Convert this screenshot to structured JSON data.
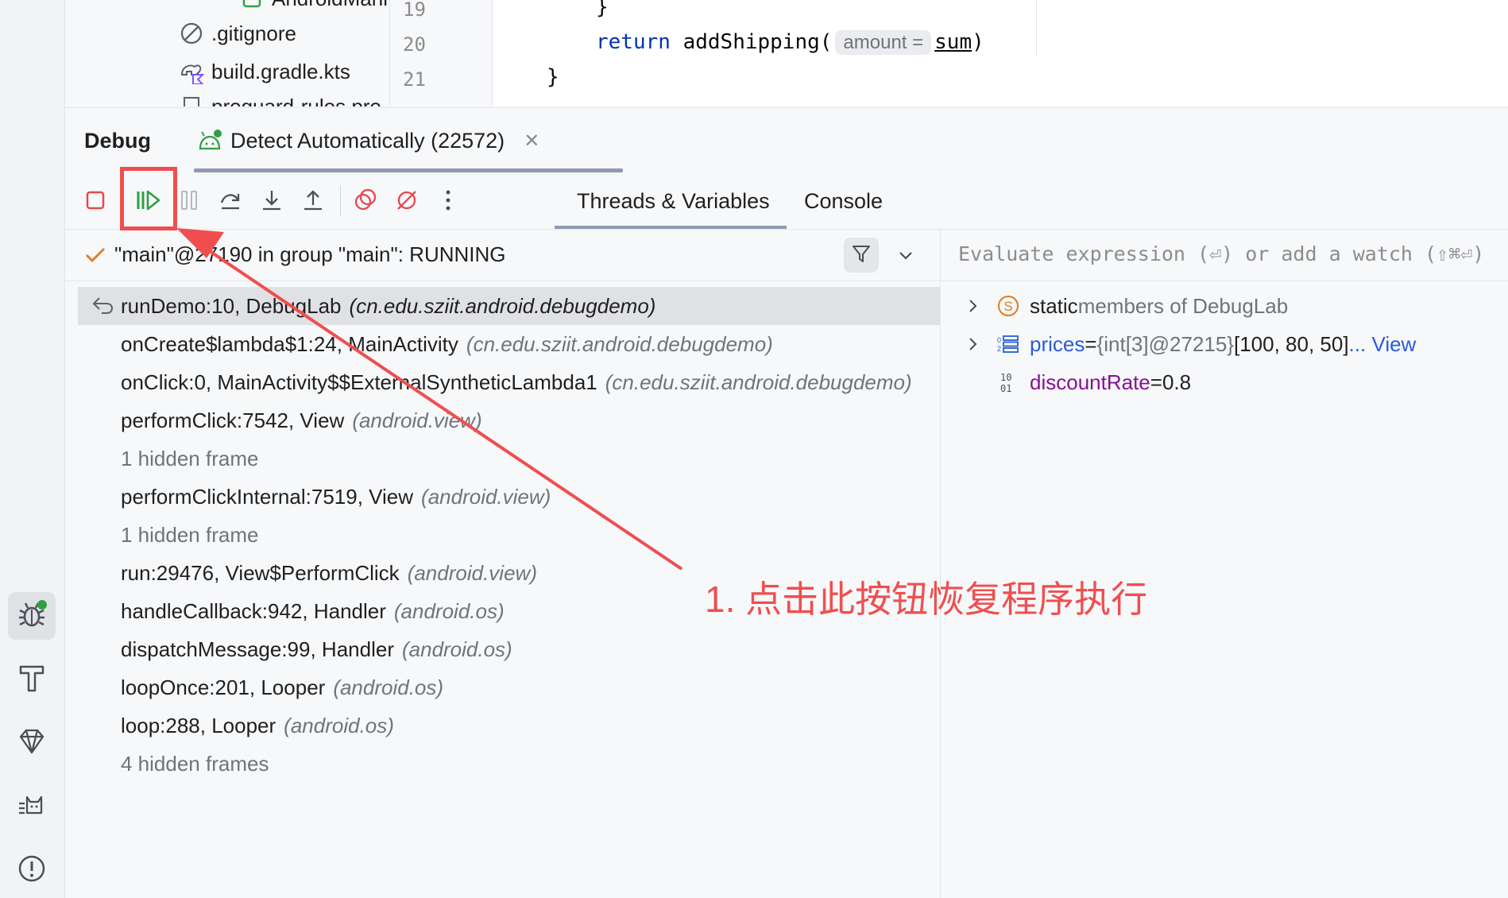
{
  "project_tree": {
    "items": [
      {
        "label": "AndroidMani",
        "icon": "android-manifest-icon"
      },
      {
        "label": ".gitignore",
        "icon": "ignore-file-icon"
      },
      {
        "label": "build.gradle.kts",
        "icon": "gradle-kotlin-icon"
      },
      {
        "label": "proguard-rules.pro",
        "icon": "file-icon"
      }
    ]
  },
  "editor": {
    "line_numbers": [
      "19",
      "20",
      "21"
    ],
    "lines": {
      "l19": "}",
      "l20_keyword": "return",
      "l20_call": "addShipping(",
      "l20_hint": "amount =",
      "l20_arg": "sum",
      "l20_close": ")",
      "l21": "}"
    }
  },
  "debug": {
    "title": "Debug",
    "session_tab": "Detect Automatically (22572)",
    "tabs": [
      "Threads & Variables",
      "Console"
    ],
    "thread_status": "\"main\"@27190 in group \"main\": RUNNING",
    "frames": [
      {
        "method": "runDemo:10, DebugLab",
        "pkg": "(cn.edu.sziit.android.debugdemo)",
        "selected": true
      },
      {
        "method": "onCreate$lambda$1:24, MainActivity",
        "pkg": "(cn.edu.sziit.android.debugdemo)"
      },
      {
        "method": "onClick:0, MainActivity$$ExternalSyntheticLambda1",
        "pkg": "(cn.edu.sziit.android.debugdemo)"
      },
      {
        "method": "performClick:7542, View",
        "pkg": "(android.view)"
      },
      {
        "method": "1 hidden frame",
        "pkg": "",
        "hidden": true
      },
      {
        "method": "performClickInternal:7519, View",
        "pkg": "(android.view)"
      },
      {
        "method": "1 hidden frame",
        "pkg": "",
        "hidden": true
      },
      {
        "method": "run:29476, View$PerformClick",
        "pkg": "(android.view)"
      },
      {
        "method": "handleCallback:942, Handler",
        "pkg": "(android.os)"
      },
      {
        "method": "dispatchMessage:99, Handler",
        "pkg": "(android.os)"
      },
      {
        "method": "loopOnce:201, Looper",
        "pkg": "(android.os)"
      },
      {
        "method": "loop:288, Looper",
        "pkg": "(android.os)"
      },
      {
        "method": "4 hidden frames",
        "pkg": "",
        "hidden": true
      }
    ],
    "eval_placeholder": "Evaluate expression (⏎) or add a watch (⇧⌘⏎)",
    "variables": [
      {
        "name": "static",
        "rest": " members of DebugLab",
        "icon": "static-members-icon"
      },
      {
        "name": "prices",
        "eq": " = ",
        "type": "{int[3]@27215}",
        "value": " [100, 80, 50] ",
        "link": "... View",
        "icon": "array-icon"
      },
      {
        "name": "discountRate",
        "eq": " = ",
        "value": "0.8",
        "icon": "primitive-icon"
      }
    ]
  },
  "annotation": {
    "text": "1. 点击此按钮恢复程序执行",
    "color": "#f04e4e"
  },
  "colors": {
    "accent_green": "#2ea043",
    "stop_red": "#e5484d",
    "keyword_blue": "#0033b3",
    "var_name_red": "#871094",
    "link_blue": "#2a5bd7"
  }
}
